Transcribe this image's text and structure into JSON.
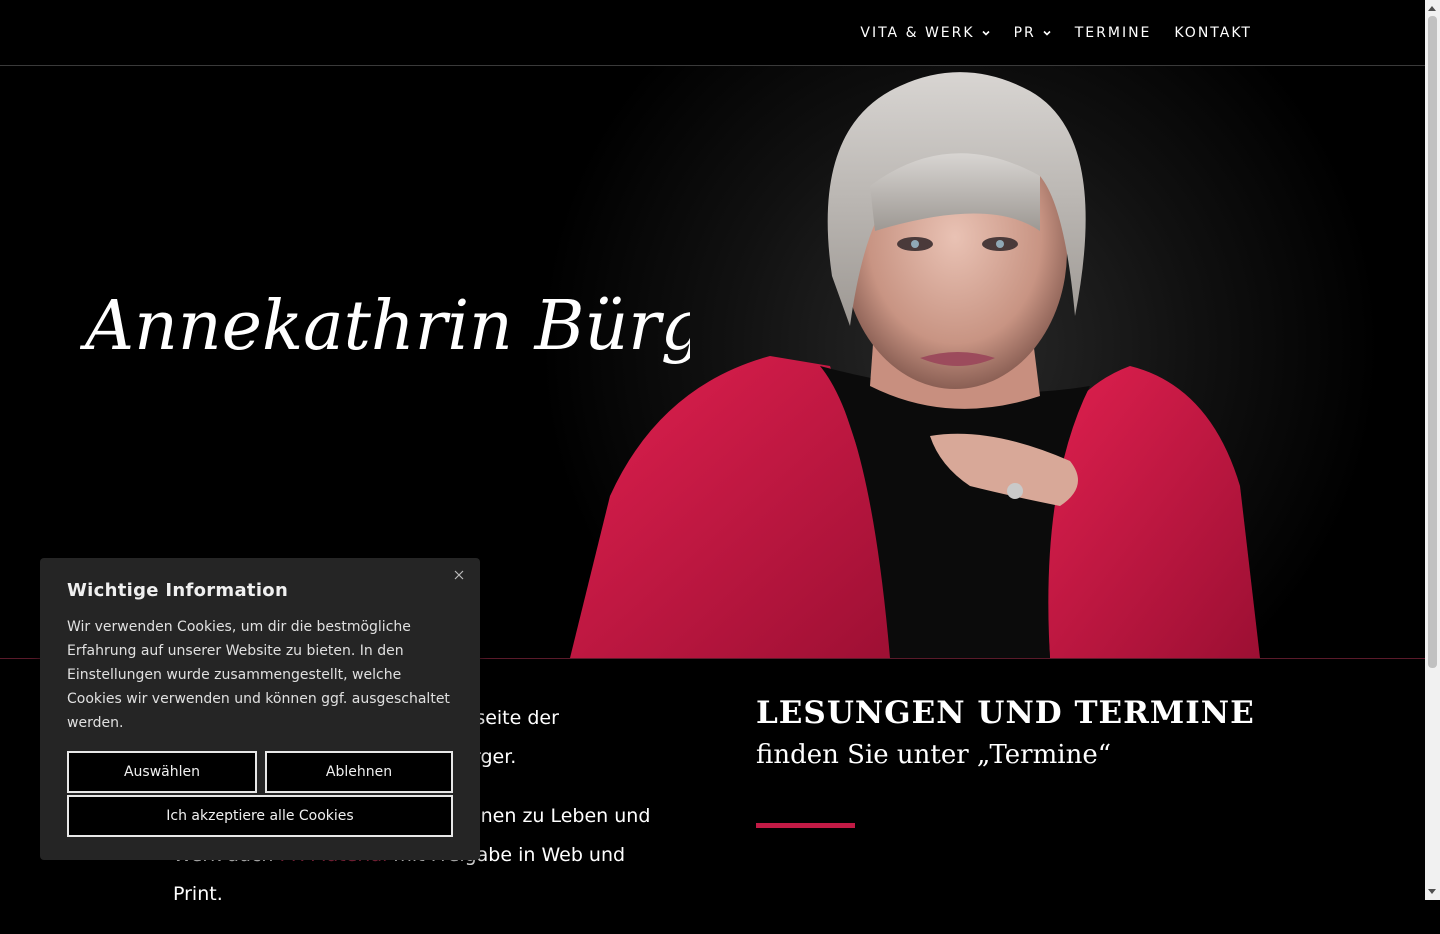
{
  "nav": {
    "items": [
      {
        "label": "VITA & WERK",
        "has_dropdown": true
      },
      {
        "label": "PR",
        "has_dropdown": true
      },
      {
        "label": "TERMINE",
        "has_dropdown": false
      },
      {
        "label": "KONTAKT",
        "has_dropdown": false
      }
    ]
  },
  "hero": {
    "signature_text": "Annekathrin Bürger"
  },
  "intro": {
    "p1_visible": "foseite der",
    "p1_line2": "rger.",
    "p2_line1": "onen zu Leben und",
    "p2_line2_a": "Werk auch ",
    "p2_link": "PR-Material",
    "p2_line2_b": " mit Freigabe in Web und",
    "p2_line3": "Print."
  },
  "events": {
    "title": "LESUNGEN UND TERMINE",
    "subtitle": "finden Sie unter „Termine“"
  },
  "cookie": {
    "title": "Wichtige Information",
    "text": "Wir verwenden Cookies, um dir die bestmögliche Erfahrung auf unserer Website zu bieten. In den Einstellungen wurde zusammengestellt, welche Cookies wir verwenden und können ggf. ausgeschaltet werden.",
    "select_label": "Auswählen",
    "reject_label": "Ablehnen",
    "accept_label": "Ich akzeptiere alle Cookies"
  },
  "colors": {
    "accent": "#c21a45",
    "background": "#000000",
    "cookie_bg": "#252525"
  }
}
